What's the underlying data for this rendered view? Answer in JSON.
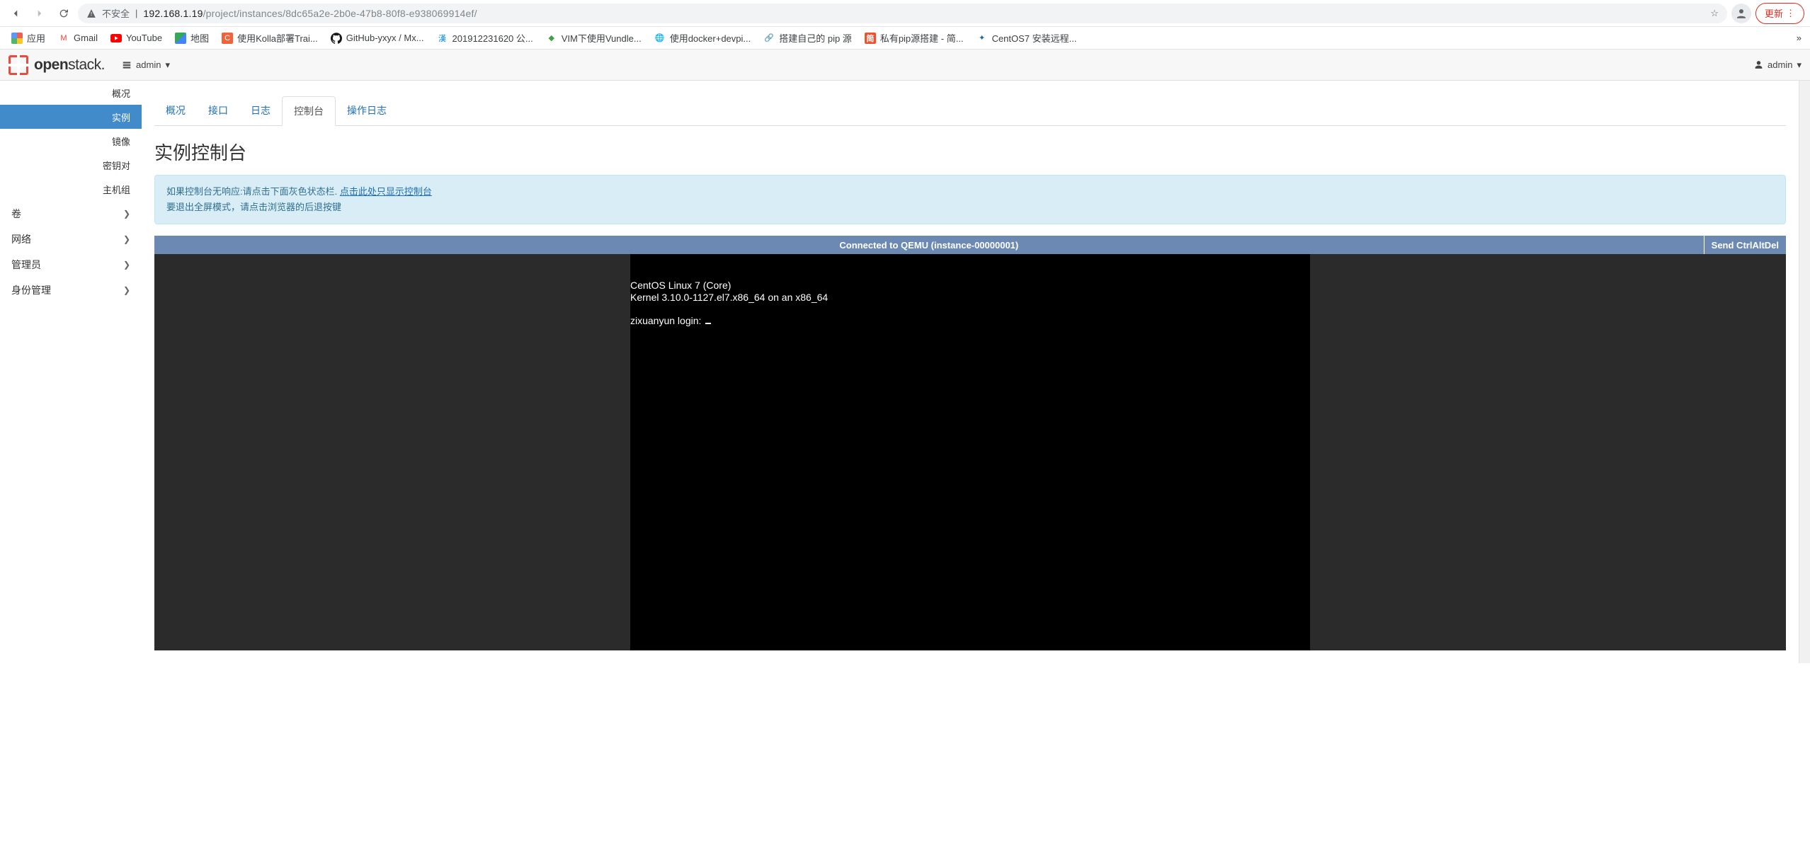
{
  "browser": {
    "not_secure": "不安全",
    "url_host": "192.168.1.19",
    "url_path": "/project/instances/8dc65a2e-2b0e-47b8-80f8-e938069914ef/",
    "update_label": "更新"
  },
  "bookmarks": {
    "apps": "应用",
    "gmail": "Gmail",
    "youtube": "YouTube",
    "maps": "地图",
    "kolla": "使用Kolla部署Trai...",
    "github": "GitHub-yxyx / Mx...",
    "numdate": "201912231620 公...",
    "vim": "VIM下使用Vundle...",
    "docker": "使用docker+devpi...",
    "pip": "搭建自己的 pip 源",
    "pvt_pip": "私有pip源搭建 - 简...",
    "centos": "CentOS7 安装远程..."
  },
  "header": {
    "logo_text_bold": "open",
    "logo_text_rest": "stack.",
    "domain_label": "admin",
    "user_label": "admin"
  },
  "sidenav": {
    "items": [
      "概况",
      "实例",
      "镜像",
      "密钥对",
      "主机组"
    ],
    "active_index": 1,
    "groups": [
      "卷",
      "网络",
      "管理员",
      "身份管理"
    ]
  },
  "tabs": {
    "items": [
      "概况",
      "接口",
      "日志",
      "控制台",
      "操作日志"
    ],
    "active_index": 3
  },
  "section_title": "实例控制台",
  "alert": {
    "line1_prefix": "如果控制台无响应:请点击下面灰色状态栏. ",
    "link": "点击此处只显示控制台",
    "line2": "要退出全屏模式，请点击浏览器的后退按键"
  },
  "console": {
    "status": "Connected to QEMU (instance-00000001)",
    "cad": "Send CtrlAltDel",
    "line1": "CentOS Linux 7 (Core)",
    "line2": "Kernel 3.10.0-1127.el7.x86_64 on an x86_64",
    "line3": "zixuanyun login: "
  }
}
